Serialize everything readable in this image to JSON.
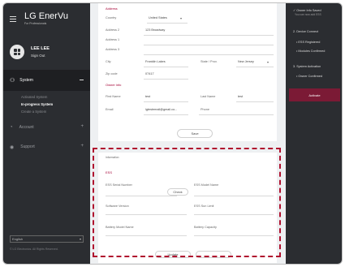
{
  "sidebar": {
    "brand": "LG EnerVu",
    "brand_sub": "For Professionals",
    "user_name": "LEE LEE",
    "user_action": "Sign Out",
    "system_label": "System",
    "system_items": [
      "Activated System",
      "In-progress System",
      "Create a System"
    ],
    "account_label": "Account",
    "support_label": "Support",
    "language": "English",
    "copyright": "© LG Electronics. All Rights Reserved."
  },
  "address": {
    "section_title": "Address",
    "country_label": "Country",
    "country_value": "United States",
    "address2_label": "Address 2",
    "address1_label": "Address 1",
    "address1_value": "123 Broadway",
    "address3_label": "Address 3",
    "city_label": "City",
    "city_value": "Franklin Lakes",
    "state_label": "State / Prov.",
    "state_value": "New Jersey",
    "zip_label": "Zip code",
    "zip_value": "07417"
  },
  "owner": {
    "section_title": "Owner info",
    "first_name_label": "First Name",
    "first_name_value": "test",
    "last_name_label": "Last Name",
    "last_name_value": "test",
    "email_label": "Email",
    "email_value": "lgtestemail@gmail.co...",
    "phone_label": "Phone",
    "save_button": "Save"
  },
  "ess": {
    "section_header": "Information",
    "title": "ESS",
    "serial_label": "ESS Serial Number",
    "check_button": "Check",
    "model_label": "ESS Model Name",
    "software_label": "Software Version",
    "sun_label": "ESS Sun Limit",
    "battery_model_label": "Battery Model Name",
    "battery_capacity_label": "Battery Capacity",
    "update_button": "Update"
  },
  "right_panel": {
    "owner_info_saved": "Owner Info Saved",
    "owner_info_sub": "You can now add ESS",
    "device_connect": "2. Device Connect",
    "ess_registered": "ESS Registered",
    "modules_confirmed": "Modules Confirmed",
    "system_activation": "3. System Activation",
    "owner_confirmed": "Owner Confirmed",
    "activate_button": "Activate"
  }
}
